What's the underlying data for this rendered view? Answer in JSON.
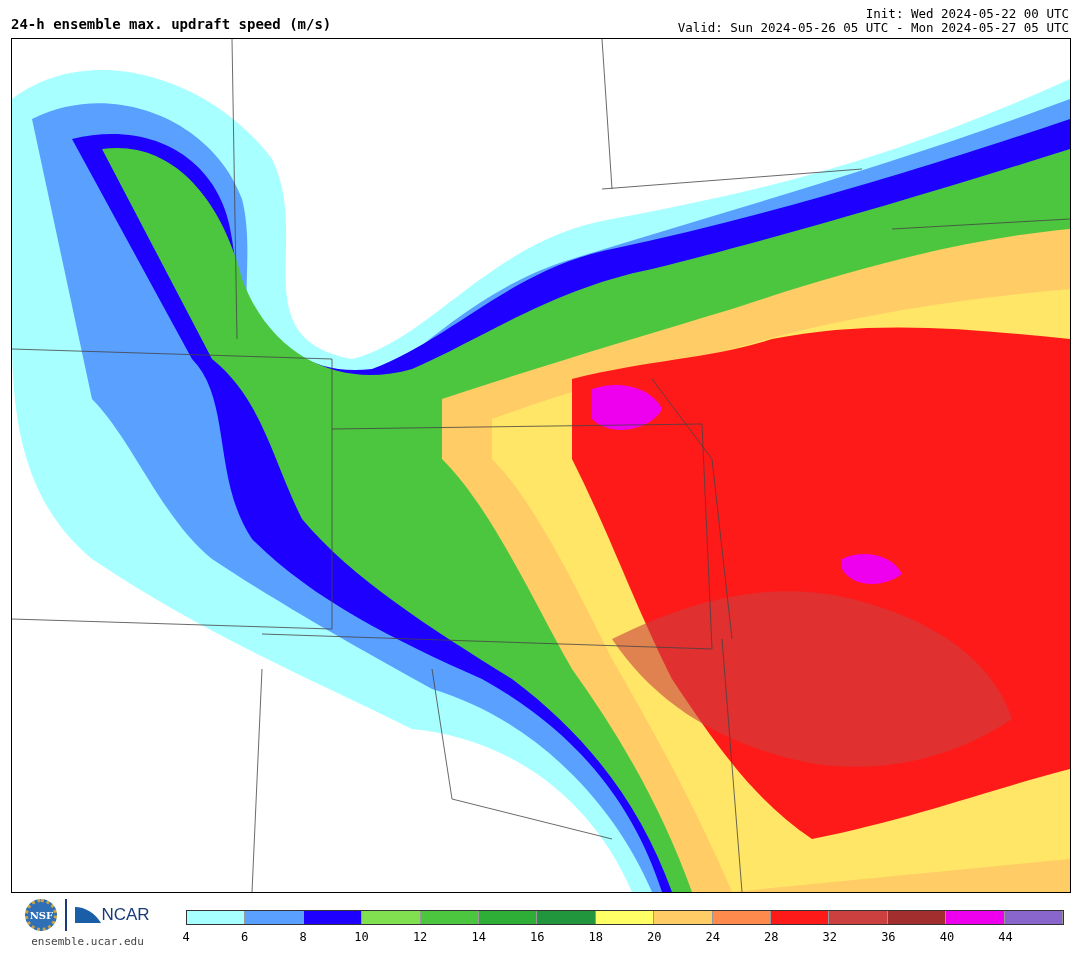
{
  "header": {
    "title": "24-h ensemble max. updraft speed (m/s)",
    "init": "Init: Wed 2024-05-22 00 UTC",
    "valid": "Valid: Sun 2024-05-26 05 UTC - Mon 2024-05-27 05 UTC"
  },
  "footer": {
    "logos": [
      "NSF",
      "NCAR"
    ],
    "site": "ensemble.ucar.edu"
  },
  "colorbar": [
    {
      "label": "4",
      "color": "#a8ffff"
    },
    {
      "label": "6",
      "color": "#5aa0ff"
    },
    {
      "label": "8",
      "color": "#1e00ff"
    },
    {
      "label": "10",
      "color": "#80e050"
    },
    {
      "label": "12",
      "color": "#4cc63f"
    },
    {
      "label": "14",
      "color": "#2eae36"
    },
    {
      "label": "16",
      "color": "#21963c"
    },
    {
      "label": "18",
      "color": "#ffff66"
    },
    {
      "label": "20",
      "color": "#ffcc66"
    },
    {
      "label": "24",
      "color": "#ff8a4d"
    },
    {
      "label": "28",
      "color": "#ff1a1a"
    },
    {
      "label": "32",
      "color": "#cc4040"
    },
    {
      "label": "36",
      "color": "#a32e2e"
    },
    {
      "label": "40",
      "color": "#ee00ee"
    },
    {
      "label": "44",
      "color": "#8866cc"
    }
  ]
}
